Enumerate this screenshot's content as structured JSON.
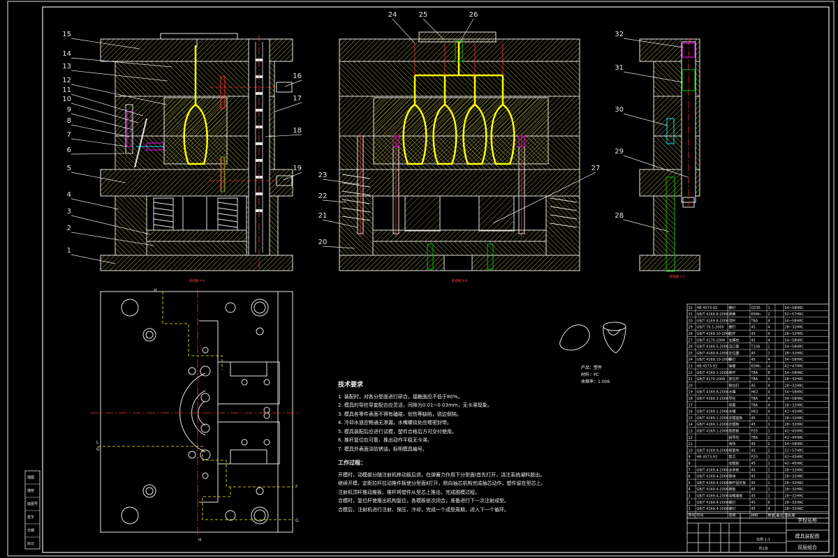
{
  "balloons_main": [
    "1",
    "2",
    "3",
    "4",
    "5",
    "6",
    "7",
    "8",
    "9",
    "10",
    "11",
    "12",
    "13",
    "14",
    "15",
    "16",
    "17",
    "18",
    "19"
  ],
  "balloons_mid": [
    "20",
    "21",
    "22",
    "23",
    "24",
    "25",
    "26",
    "27"
  ],
  "balloons_right": [
    "28",
    "29",
    "30",
    "31",
    "32"
  ],
  "view_labels": [
    "剖视图 A-A",
    "剖视图 B-B",
    "剖视图 C-C"
  ],
  "section_marks": {
    "h": "H",
    "g": "G",
    "l": "L",
    "f": "F"
  },
  "tech_requirements": {
    "title": "技术要求",
    "items": [
      "1. 装配时，对各分型面进行研合，接触面应不低于80%。",
      "2. 模具的导柱导套配合应灵活，间隙为0.01~0.03mm，无卡滞现象。",
      "3. 模具各零件表面不得有磕碰、划伤等缺陷，锐边倒钝。",
      "4. 冷却水道应畅通无渗漏，水嘴螺纹处应缠密封带。",
      "5. 模具装配后应进行试模，塑件合格后方可交付使用。",
      "6. 推杆复位应可靠，推出动作平稳无卡滞。",
      "7. 模具外表面涂防锈油，标明模具编号。"
    ]
  },
  "work_process": {
    "title": "工作过程：",
    "lines": [
      "开模时，动模部分随注射机移动板后退，在弹簧力作用下分型面Ⅰ首先打开，浇注系统凝料脱出。",
      "继续开模，定距拉杆拉动推件板使分型面Ⅱ打开，侧向抽芯机构完成抽芯动作，塑件留在型芯上。",
      "注射机顶杆推动推板，推杆将塑件从型芯上推出，完成脱模过程。",
      "合模时，复位杆使推出机构复位，各模板依次闭合，准备进行下一次注射成型。",
      "合模后，注射机进行注射、保压、冷却，完成一个成型周期，进入下一个循环。"
    ]
  },
  "product_info": {
    "line1": "产品：塑件",
    "line2": "材料：PC",
    "line3": "收缩率：1.006"
  },
  "bom_rows": [
    [
      "32",
      "HB 4573-92",
      "螺钉",
      "Q235",
      "1",
      "",
      "54~58HRC"
    ],
    [
      "31",
      "GB/T 4169.8-2006",
      "弹簧",
      "65Mn",
      "2",
      "",
      "52~57HRC"
    ],
    [
      "30",
      "GB/T 4169.8-2006",
      "顶杆",
      "T8A",
      "4",
      "",
      "54~58HRC"
    ],
    [
      "29",
      "GB/T 70.1-2000",
      "螺钉",
      "45",
      "4",
      "",
      "28~32HRC"
    ],
    [
      "28",
      "GB/T 4169.10-2006",
      "拉杆",
      "45",
      "4",
      "",
      "28~32HRC"
    ],
    [
      "27",
      "GB/T 4170-2006",
      "支撑柱",
      "45",
      "4",
      "",
      "54~58HRC"
    ],
    [
      "26",
      "GB/T 4169.5-2006",
      "浇口套",
      "T10A",
      "1",
      "",
      "54~58HRC"
    ],
    [
      "25",
      "GB/T 4169.6-2006",
      "定位圈",
      "45",
      "1",
      "",
      "28~32HRC"
    ],
    [
      "24",
      "GB/T 4169.10-2006",
      "螺钉",
      "45",
      "4",
      "",
      "54~58HRC"
    ],
    [
      "23",
      "HB 4573-92",
      "弹簧",
      "65Mn",
      "4",
      "",
      "42~47HRC"
    ],
    [
      "22",
      "GB/T 4169.1-2006",
      "推杆",
      "T8A",
      "8",
      "",
      "54~58HRC"
    ],
    [
      "21",
      "GB/T 4170-2006",
      "复位杆",
      "T8A",
      "4",
      "",
      "28~32HRC"
    ],
    [
      "20",
      "",
      "限位钉",
      "45",
      "4",
      "",
      "28~32HRC"
    ],
    [
      "19",
      "GB/T 4169.8-2006",
      "水嘴",
      "H62",
      "4",
      "",
      "54~58HRC"
    ],
    [
      "18",
      "GB/T 4169.3-2006",
      "导柱",
      "T8A",
      "4",
      "",
      "54~58HRC"
    ],
    [
      "17",
      "",
      "导套",
      "T8A",
      "4",
      "",
      "28~32HRC"
    ],
    [
      "16",
      "GB/T 4169.1-2006",
      "水嘴",
      "H62",
      "4",
      "",
      "42~45HRC"
    ],
    [
      "15",
      "GB/T 4169.1-2006",
      "定模座板",
      "45",
      "1",
      "",
      "28~32HRC"
    ],
    [
      "14",
      "GB/T 4169.1-2006",
      "定模板",
      "45",
      "1",
      "",
      "28~32HRC"
    ],
    [
      "13",
      "GB/T 4169.1-2006",
      "型腔板",
      "P20",
      "1",
      "",
      "42~45HRC"
    ],
    [
      "12",
      "",
      "斜导柱",
      "T8A",
      "2",
      "",
      "42~45HRC"
    ],
    [
      "11",
      "",
      "滑块",
      "45",
      "2",
      "",
      "54~58HRC"
    ],
    [
      "10",
      "GB/T 4169.9-2006",
      "楔紧块",
      "45",
      "2",
      "",
      "52~57HRC"
    ],
    [
      "9",
      "HB 4573-92",
      "型芯",
      "P20",
      "1",
      "",
      "42~45HRC"
    ],
    [
      "8",
      "",
      "动模板",
      "45",
      "1",
      "",
      "42~45HRC"
    ],
    [
      "7",
      "GB/T 4169.4-2006",
      "支承板",
      "45",
      "1",
      "",
      "28~32HRC"
    ],
    [
      "6",
      "GB/T 4169.4-2006",
      "垫块",
      "45",
      "2",
      "",
      "28~32HRC"
    ],
    [
      "5",
      "GB/T 4169.4-2006",
      "推杆固定板",
      "45",
      "1",
      "",
      "28~32HRC"
    ],
    [
      "4",
      "GB/T 4169.4-2006",
      "推板",
      "45",
      "1",
      "",
      "28~32HRC"
    ],
    [
      "3",
      "GB/T 4169.4-2006",
      "动模座板",
      "45",
      "1",
      "",
      "28~32HRC"
    ],
    [
      "2",
      "GB/T 4169.4-2006",
      "螺钉",
      "45",
      "6",
      "",
      "28~32HRC"
    ],
    [
      "1",
      "GB/T 4169.4-2006",
      "螺钉",
      "45",
      "4",
      "",
      "28~32HRC"
    ]
  ],
  "bom_header": [
    "序号",
    "代号",
    "名称",
    "材料",
    "数量",
    "备注",
    "热处理"
  ],
  "title_block": {
    "school": "学校名称",
    "drawing_name": "模具装配图",
    "drawing_no": "双层组合",
    "scale_label": "比例 1:1",
    "sheet_label": "共1张"
  },
  "left_strip": [
    "描图",
    "描校",
    "底图号",
    "签字",
    "日期",
    "标记"
  ],
  "colors": {
    "background": "#000000",
    "outline": "#e8e8e8",
    "hatch": "#b8b04a",
    "yellow": "#ffff00",
    "red": "#ff3030",
    "magenta": "#ff00ff",
    "green": "#00c000",
    "cyan": "#00e0ff"
  }
}
